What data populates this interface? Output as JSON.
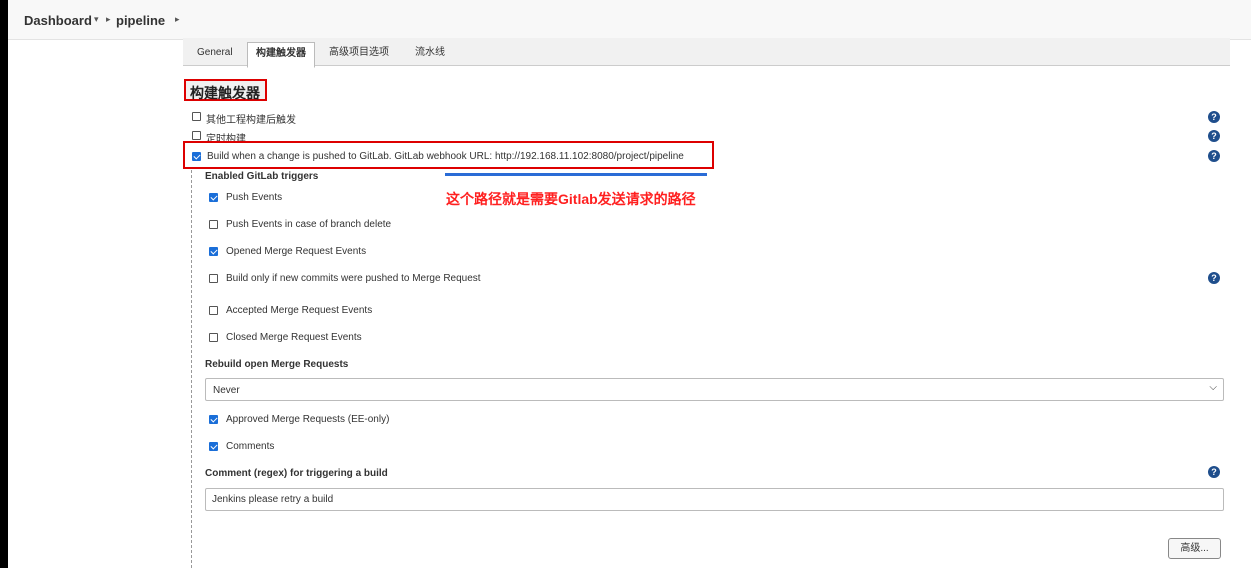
{
  "breadcrumb": {
    "dashboard": "Dashboard",
    "dashboard_caret": "▾",
    "sep1": "▸",
    "project": "pipeline",
    "sep2": "▸"
  },
  "tabs": [
    {
      "label": "General"
    },
    {
      "label": "构建触发器",
      "active": true
    },
    {
      "label": "高级项目选项"
    },
    {
      "label": "流水线"
    }
  ],
  "section": {
    "title": "构建触发器"
  },
  "triggers": {
    "other_projects": {
      "label": "其他工程构建后触发",
      "checked": false
    },
    "periodic": {
      "label": "定时构建",
      "checked": false
    },
    "gitlab": {
      "label": "Build when a change is pushed to GitLab. GitLab webhook URL: http://192.168.11.102:8080/project/pipeline",
      "checked": true
    }
  },
  "annotation": {
    "text": "这个路径就是需要Gitlab发送请求的路径",
    "color": "#ff2020"
  },
  "gitlab": {
    "enabled_title": "Enabled GitLab triggers",
    "options": [
      {
        "label": "Push Events",
        "checked": true
      },
      {
        "label": "Push Events in case of branch delete",
        "checked": false
      },
      {
        "label": "Opened Merge Request Events",
        "checked": true
      },
      {
        "label": "Build only if new commits were pushed to Merge Request",
        "checked": false
      },
      {
        "label": "Accepted Merge Request Events",
        "checked": false
      },
      {
        "label": "Closed Merge Request Events",
        "checked": false
      }
    ],
    "rebuild_label": "Rebuild open Merge Requests",
    "rebuild_value": "Never",
    "approved": {
      "label": "Approved Merge Requests (EE-only)",
      "checked": true
    },
    "comments": {
      "label": "Comments",
      "checked": true
    },
    "comment_regex_label": "Comment (regex) for triggering a build",
    "comment_regex_value": "Jenkins please retry a build"
  },
  "help_icon": "?",
  "advanced_button": "高级...",
  "colors": {
    "accent": "#1a6ed8",
    "help": "#1f4e8c",
    "highlight": "#dd0000"
  }
}
